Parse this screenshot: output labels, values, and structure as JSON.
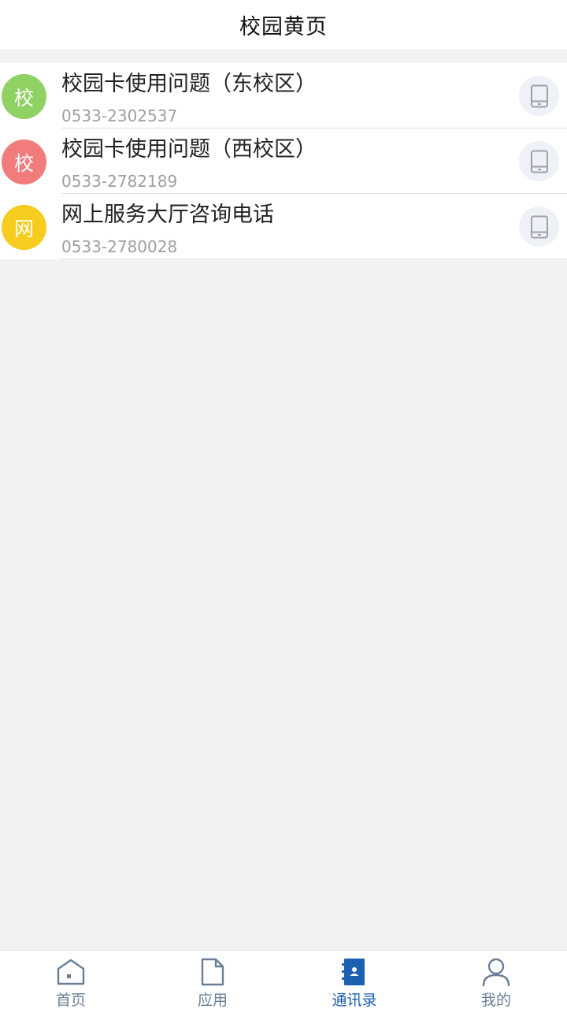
{
  "header": {
    "title": "校园黄页"
  },
  "colors": {
    "avatar_green": "#8fd162",
    "avatar_red": "#f27b7b",
    "avatar_yellow": "#f6cc1f",
    "tab_active": "#1d5fb0",
    "tab_inactive": "#6a7f97"
  },
  "contacts": [
    {
      "avatar_char": "校",
      "name": "校园卡使用问题（东校区）",
      "phone": "0533-2302537",
      "icon": "phone-icon"
    },
    {
      "avatar_char": "校",
      "name": "校园卡使用问题（西校区）",
      "phone": "0533-2782189",
      "icon": "phone-icon"
    },
    {
      "avatar_char": "网",
      "name": "网上服务大厅咨询电话",
      "phone": "0533-2780028",
      "icon": "phone-icon"
    }
  ],
  "tabs": [
    {
      "label": "首页",
      "icon": "home-icon",
      "active": false
    },
    {
      "label": "应用",
      "icon": "document-icon",
      "active": false
    },
    {
      "label": "通讯录",
      "icon": "contacts-book-icon",
      "active": true
    },
    {
      "label": "我的",
      "icon": "user-icon",
      "active": false
    }
  ]
}
